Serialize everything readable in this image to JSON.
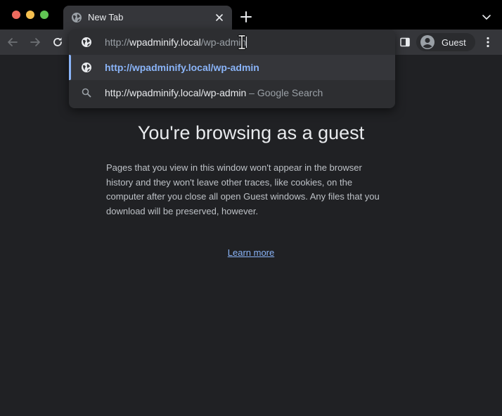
{
  "tab": {
    "title": "New Tab",
    "favicon": "globe-icon"
  },
  "toolbar": {
    "profile_label": "Guest"
  },
  "omnibox": {
    "scheme": "http://",
    "host": "wpadminify.local",
    "path": "/wp-admin",
    "suggestions": [
      {
        "text": "http://wpadminify.local/wp-admin",
        "icon": "globe-icon"
      },
      {
        "text": "http://wpadminify.local/wp-admin",
        "separator": " – ",
        "desc": "Google Search",
        "icon": "search-icon"
      }
    ]
  },
  "page": {
    "title": "You're browsing as a guest",
    "description": "Pages that you view in this window won't appear in the browser history and they won't leave other traces, like cookies, on the computer after you close all open Guest windows. Any files that you download will be preserved, however.",
    "learn_more": "Learn more"
  },
  "colors": {
    "page_bg": "#202124",
    "toolbar_bg": "#35363a",
    "accent": "#8ab4f8",
    "text": "#e8eaed"
  }
}
